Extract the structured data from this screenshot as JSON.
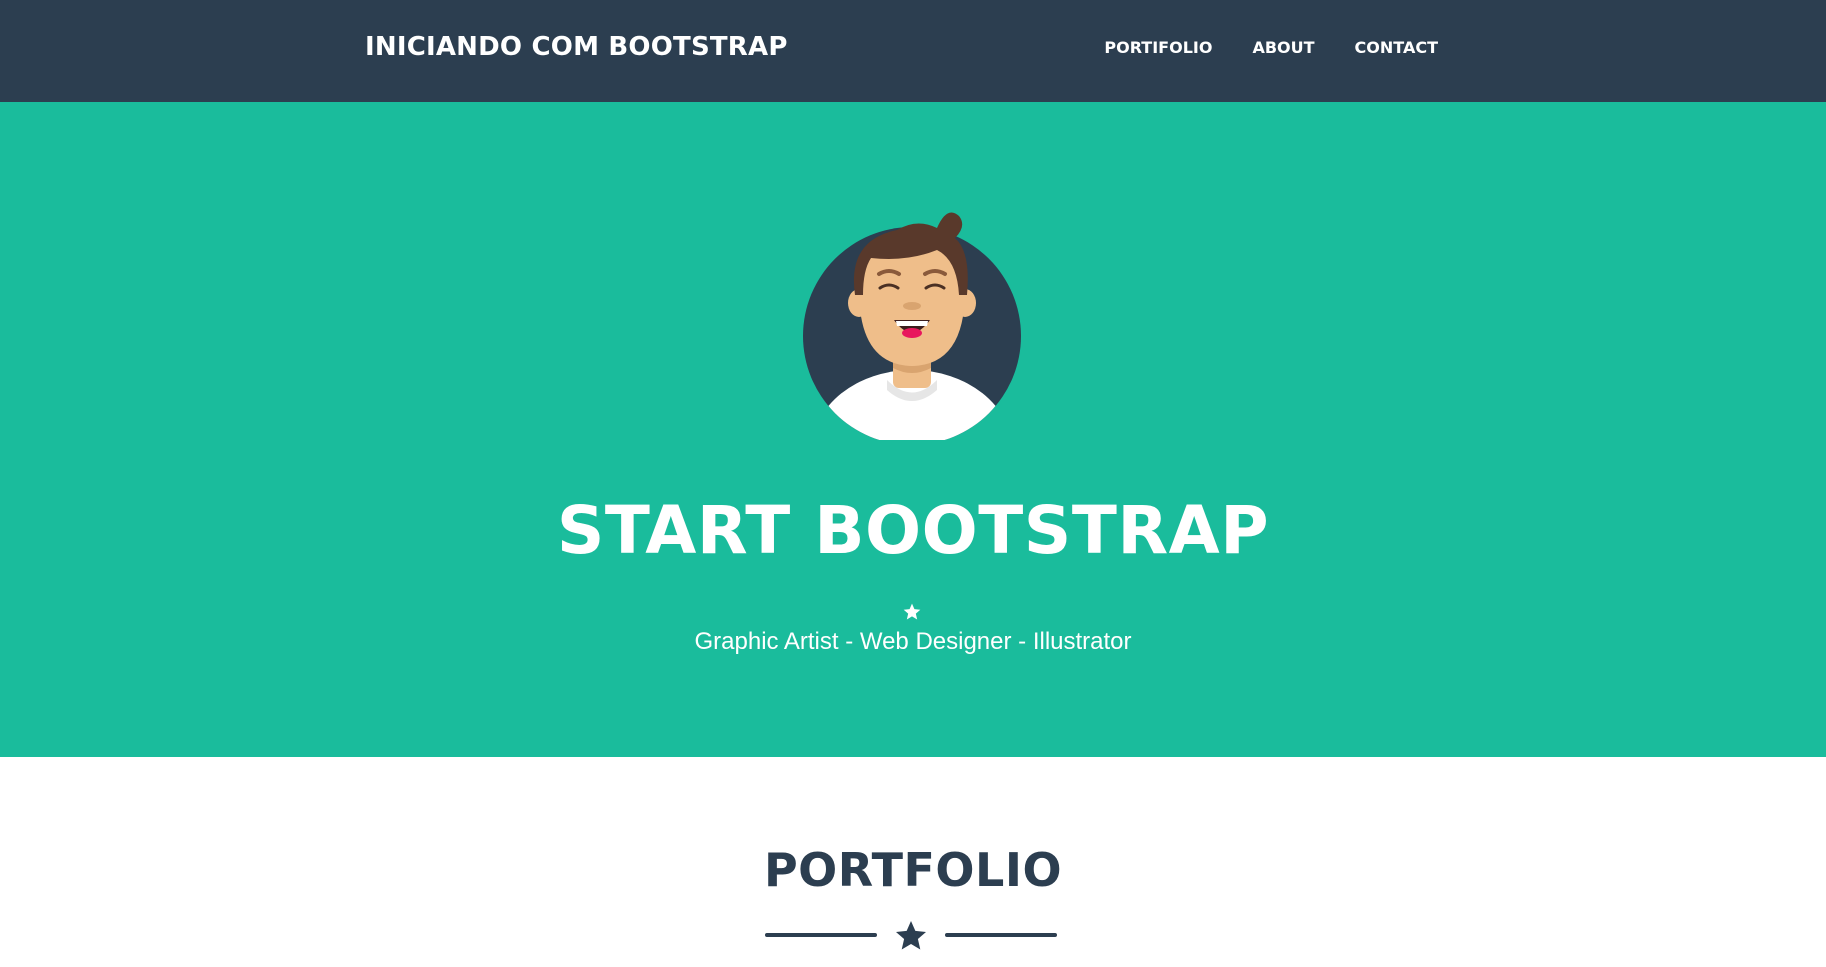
{
  "navbar": {
    "brand": "INICIANDO COM BOOTSTRAP",
    "links": [
      {
        "label": "PORTIFOLIO"
      },
      {
        "label": "ABOUT"
      },
      {
        "label": "CONTACT"
      }
    ]
  },
  "masthead": {
    "avatar_icon": "avatar-illustration",
    "heading": "START BOOTSTRAP",
    "star_icon": "star-icon",
    "subheading": "Graphic Artist - Web Designer - Illustrator"
  },
  "portfolio": {
    "heading": "PORTFOLIO",
    "divider_icon": "star-icon"
  },
  "colors": {
    "navbar": "#2c3e50",
    "masthead": "#1abc9c",
    "heading_dark": "#2c3e50",
    "text_light": "#ffffff"
  }
}
